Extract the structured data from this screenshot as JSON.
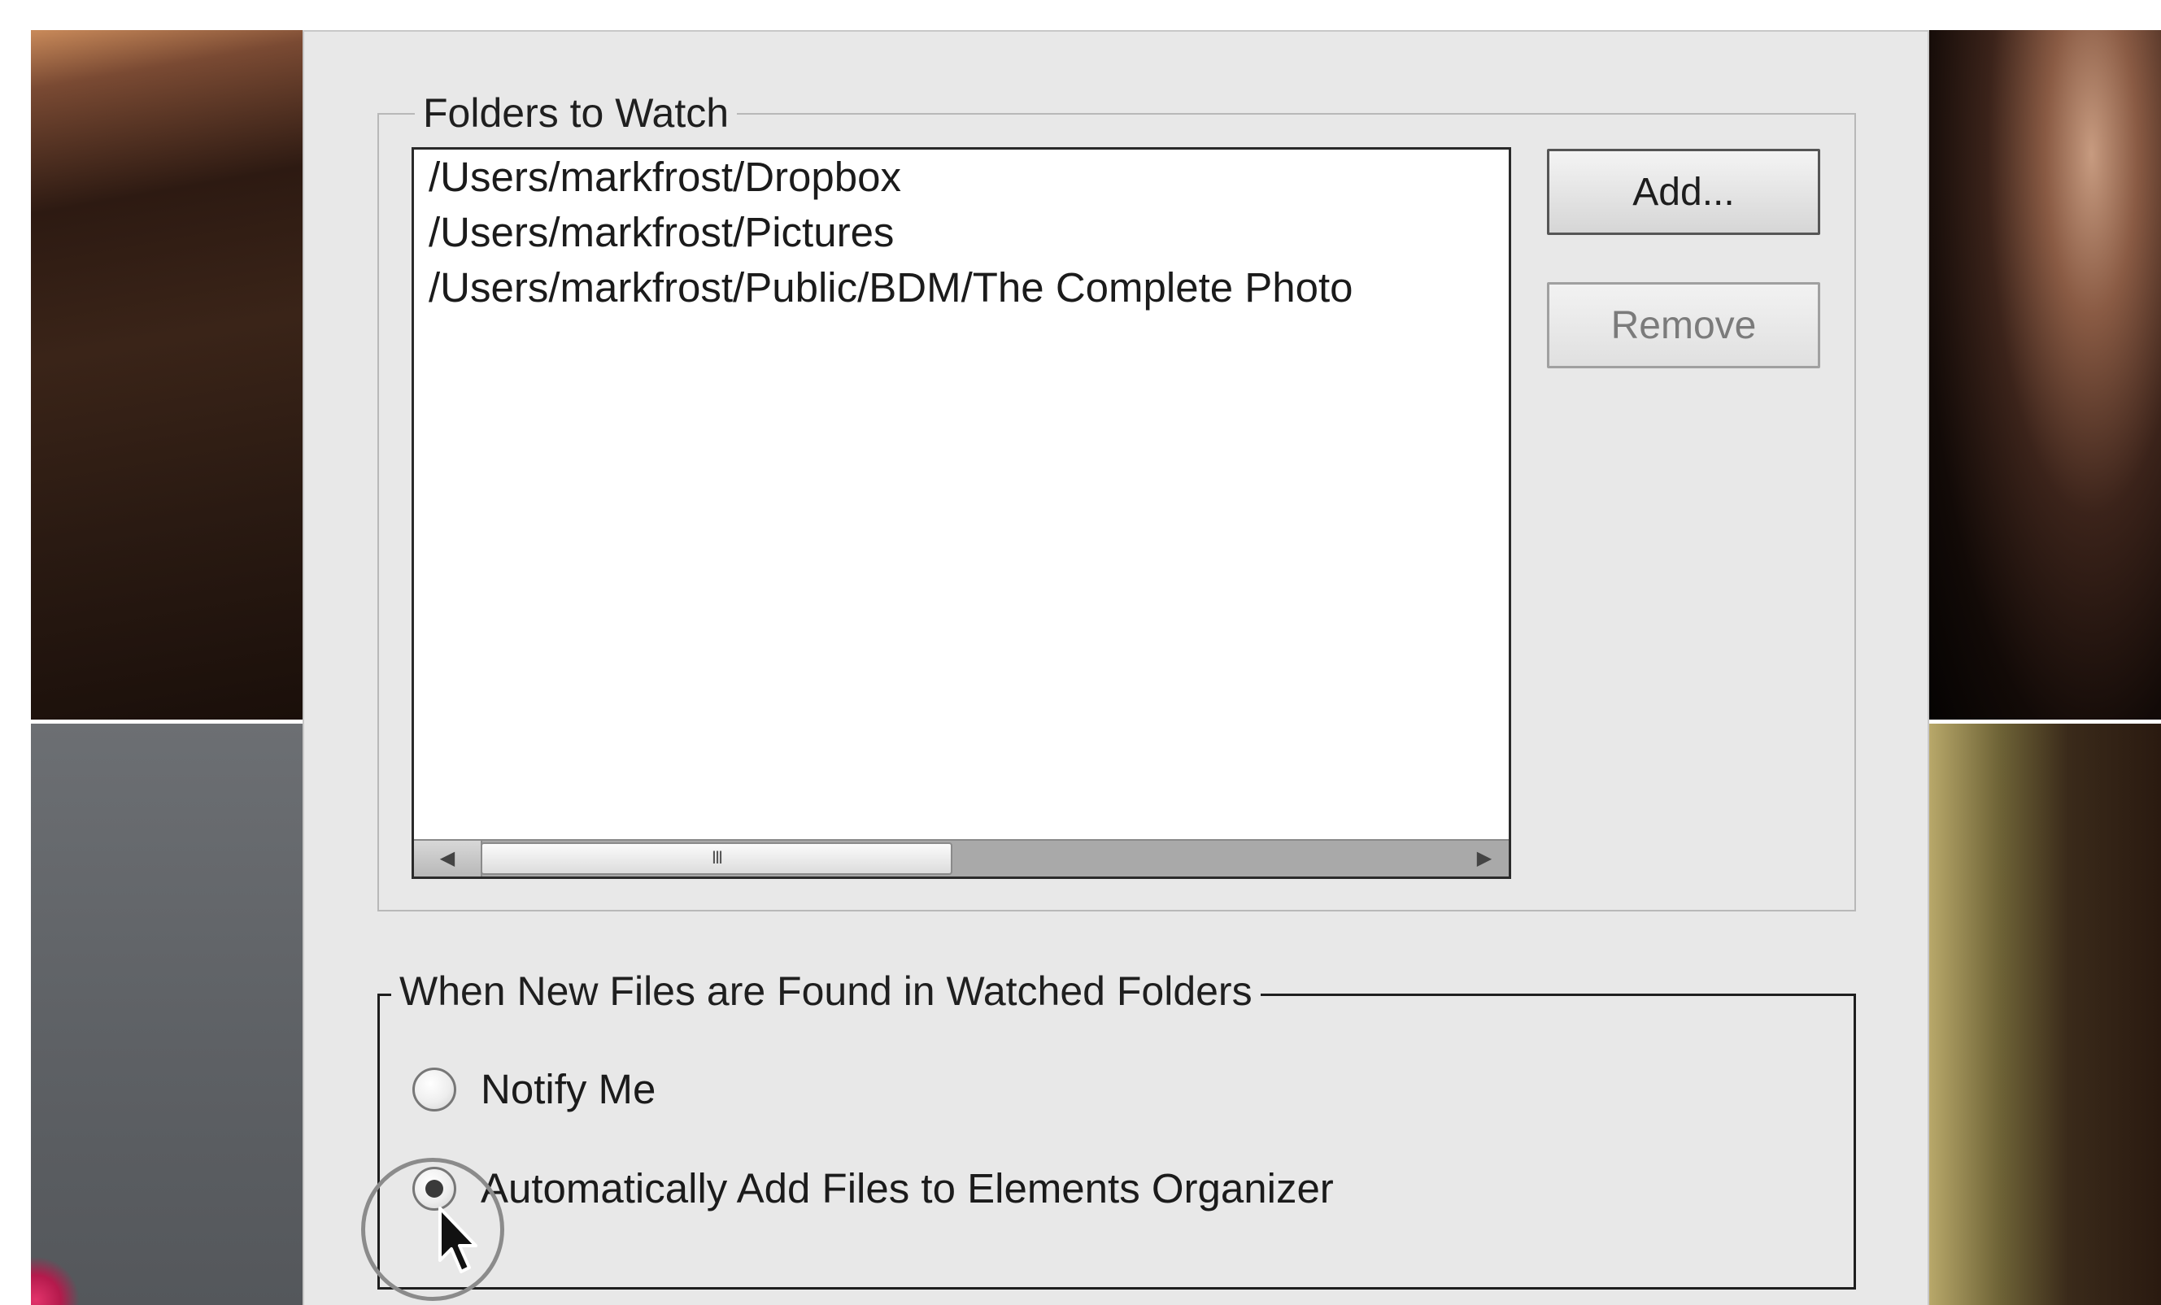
{
  "folders_group": {
    "legend": "Folders to Watch",
    "folders": [
      "/Users/markfrost/Dropbox",
      "/Users/markfrost/Pictures",
      "/Users/markfrost/Public/BDM/The Complete Photo"
    ],
    "scroll_thumb_grip": "III",
    "add_label": "Add...",
    "remove_label": "Remove"
  },
  "new_files_group": {
    "legend": "When New Files are Found in Watched Folders",
    "options": [
      {
        "label": "Notify Me",
        "selected": false
      },
      {
        "label": "Automatically Add Files to Elements Organizer",
        "selected": true
      }
    ]
  },
  "icons": {
    "scroll_left": "scroll-left-arrow-icon",
    "scroll_right": "scroll-right-arrow-icon",
    "cursor": "mouse-cursor-icon"
  },
  "colors": {
    "dialog_background": "#e8e8e8",
    "list_background": "#ffffff",
    "highlight_circle": "#8b8b8b"
  }
}
